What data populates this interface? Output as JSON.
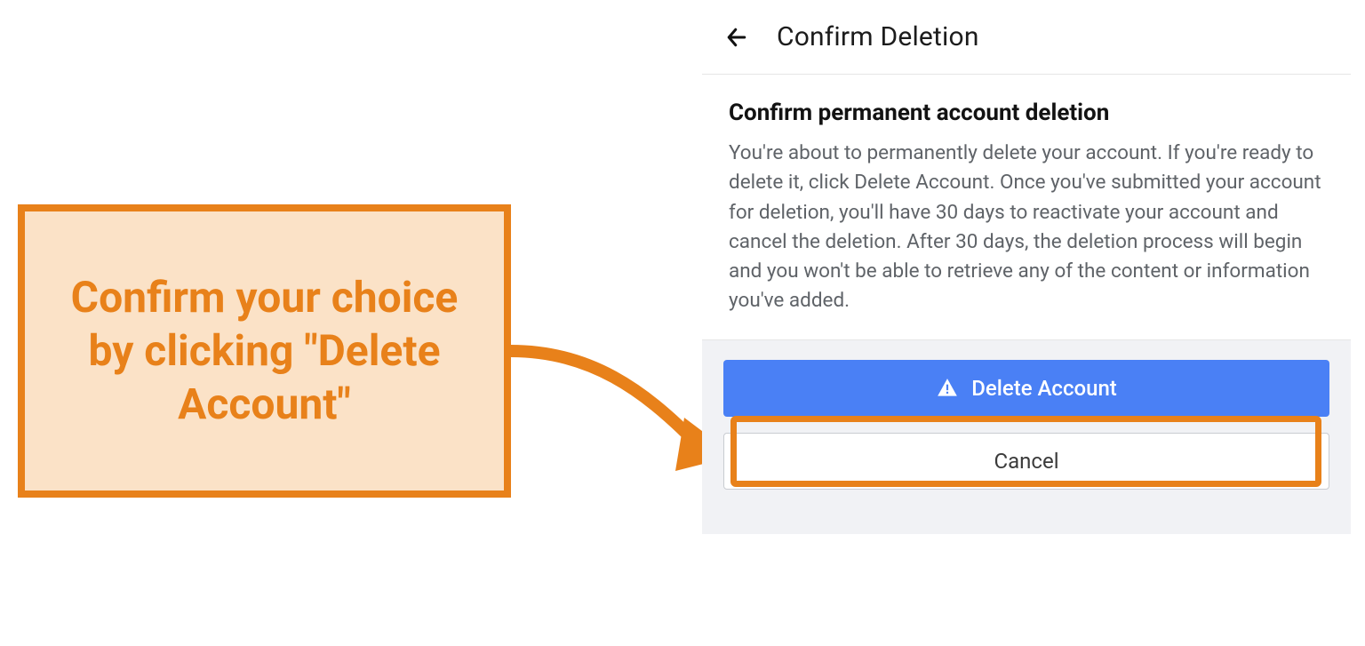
{
  "callout": {
    "text": "Confirm your choice by clicking \"Delete Account\""
  },
  "dialog": {
    "header_title": "Confirm Deletion",
    "body_heading": "Confirm permanent account deletion",
    "body_text": "You're about to permanently delete your account. If you're ready to delete it, click Delete Account. Once you've submitted your account for deletion, you'll have 30 days to reactivate your account and cancel the deletion. After 30 days, the deletion process will begin and you won't be able to retrieve any of the content or information you've added.",
    "delete_label": "Delete Account",
    "cancel_label": "Cancel"
  },
  "colors": {
    "accent_orange": "#e8811a",
    "callout_fill": "#fbe2c7",
    "primary_button": "#4a80f5"
  }
}
